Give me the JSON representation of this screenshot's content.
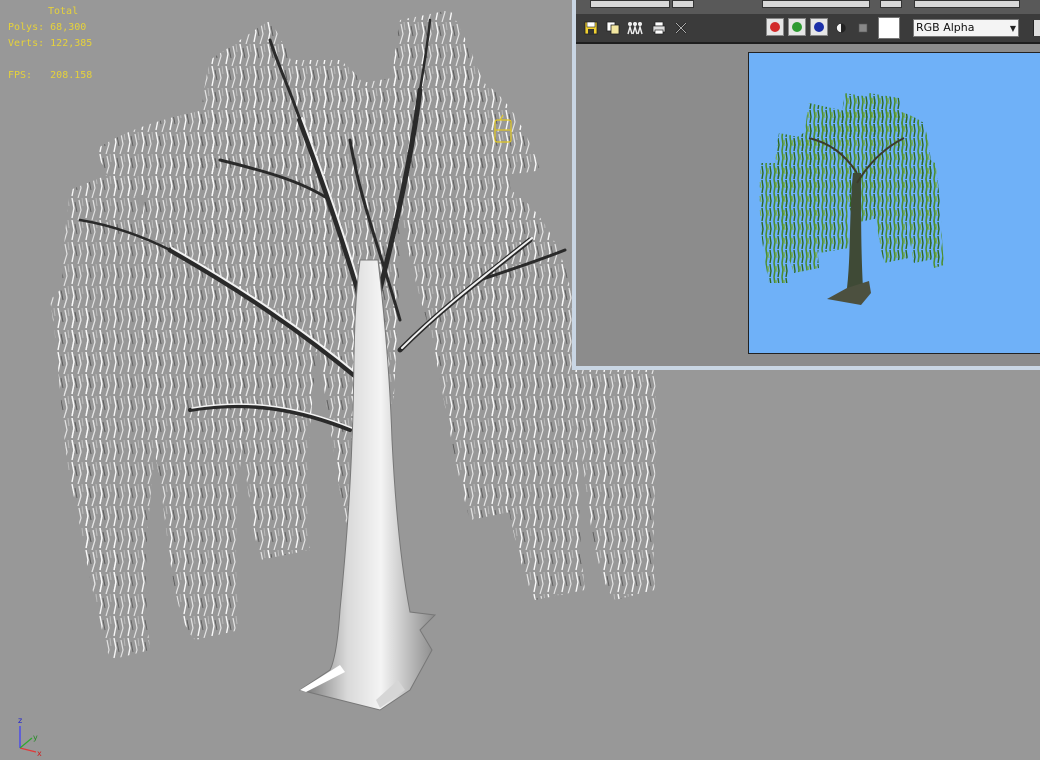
{
  "viewport": {
    "stats": {
      "total_label": "Total",
      "polys_label": "Polys:",
      "polys_value": "68,300",
      "verts_label": "Verts:",
      "verts_value": "122,385",
      "fps_label": "FPS:",
      "fps_value": "208.158"
    },
    "gizmo_axes": {
      "z": "z",
      "x": "x",
      "y": "y"
    },
    "background_color": "#989898",
    "stats_color": "#e6d23a"
  },
  "render_window": {
    "toolbar": {
      "save_icon": "save-icon",
      "clone_icon": "clone-icon",
      "print_icon": "print-icon",
      "clear_icon": "clear-icon",
      "channel_red_color": "#d22a2a",
      "channel_green_color": "#2e9b32",
      "channel_blue_color": "#1b2fa8",
      "channel_select_value": "RGB Alpha"
    },
    "preview_background": "#6fb1f8"
  }
}
